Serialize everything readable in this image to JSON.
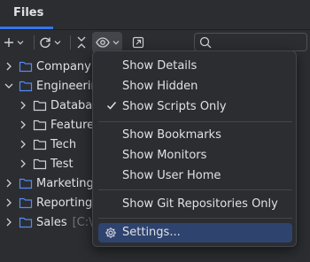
{
  "panel": {
    "tab_title": "Files"
  },
  "toolbar": {
    "add_icon": "plus-icon",
    "refresh_icon": "refresh-icon",
    "collapse_icon": "collapse-all-icon",
    "view_icon": "eye-icon",
    "open_icon": "open-in-new-icon",
    "search_icon": "search-icon",
    "search_placeholder": ""
  },
  "tree": [
    {
      "label": "Company",
      "path": "[",
      "expanded": false,
      "depth": 0
    },
    {
      "label": "Engineerin",
      "path": "",
      "expanded": true,
      "depth": 0
    },
    {
      "label": "Databas",
      "path": "",
      "expanded": false,
      "depth": 1
    },
    {
      "label": "Feature",
      "path": "",
      "expanded": false,
      "depth": 1
    },
    {
      "label": "Tech",
      "path": "",
      "expanded": false,
      "depth": 1
    },
    {
      "label": "Test",
      "path": "",
      "expanded": false,
      "depth": 1
    },
    {
      "label": "Marketing",
      "path": "",
      "expanded": false,
      "depth": 0
    },
    {
      "label": "Reporting",
      "path": "",
      "expanded": false,
      "depth": 0
    },
    {
      "label": "Sales",
      "path": "[C:\\v",
      "expanded": false,
      "depth": 0
    }
  ],
  "menu": {
    "items": [
      {
        "label": "Show Details",
        "checked": false
      },
      {
        "label": "Show Hidden",
        "checked": false
      },
      {
        "label": "Show Scripts Only",
        "checked": true
      },
      {
        "label": "Show Bookmarks",
        "checked": false
      },
      {
        "label": "Show Monitors",
        "checked": false
      },
      {
        "label": "Show User Home",
        "checked": false
      },
      {
        "label": "Show Git Repositories Only",
        "checked": false
      },
      {
        "label": "Settings...",
        "checked": false,
        "icon": "gear-icon",
        "selected": true
      }
    ]
  },
  "colors": {
    "background": "#2b2d30",
    "accent": "#3574f0",
    "selection": "#2e436e",
    "folder": "#548af7",
    "text": "#dfe1e5",
    "muted": "#6f737a"
  }
}
